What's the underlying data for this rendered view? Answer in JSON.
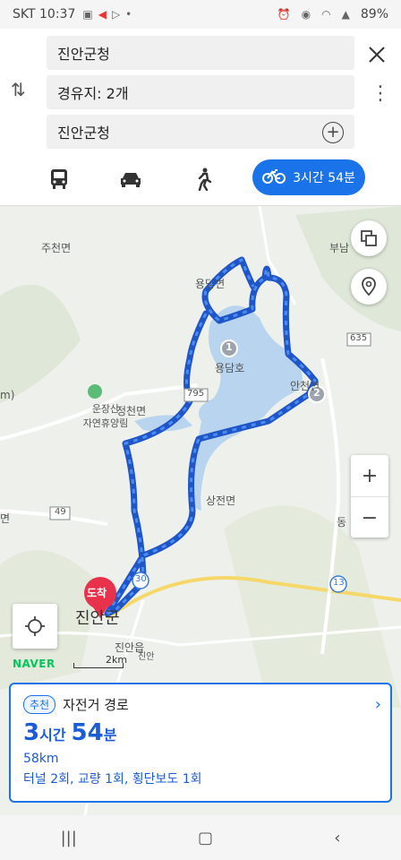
{
  "status": {
    "time": "10:37",
    "carrier": "SKT",
    "battery": "89%"
  },
  "route": {
    "origin": "진안군청",
    "waypoints": "경유지: 2개",
    "destination": "진안군청"
  },
  "modes": {
    "bike_time": "3시간 54분"
  },
  "map": {
    "labels": {
      "jucheon": "주천면",
      "yongdam": "용담면",
      "yongdamho": "용담호",
      "anchen": "안천면",
      "jeongcheon": "정천면",
      "sangjeon": "상전면",
      "jinan_gun": "진안군",
      "jinan_eup": "진안읍",
      "ic": "진안",
      "bunam": "부남",
      "forest": "운장산\n자연휴양림",
      "dong": "동",
      "myeon_left": "면",
      "m": "m)"
    },
    "road_numbers": {
      "r795": "795",
      "r635": "635",
      "r49": "49",
      "r30": "30",
      "r13": "13"
    },
    "waypoint_markers": [
      "1",
      "2"
    ],
    "dest_marker": "도착",
    "naver": "NAVER",
    "scale": "2km"
  },
  "card": {
    "badge": "추천",
    "title": "자전거 경로",
    "hours": "3",
    "hours_unit": "시간",
    "minutes": "54",
    "minutes_unit": "분",
    "distance": "58km",
    "details": "터널 2회, 교량 1회, 횡단보도 1회"
  },
  "colors": {
    "accent": "#1a73e8",
    "route": "#2b6fd8",
    "dest": "#e8314a"
  }
}
